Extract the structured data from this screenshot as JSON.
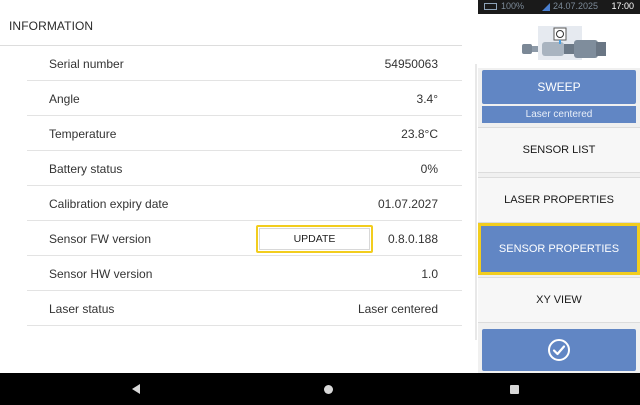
{
  "info": {
    "title": "INFORMATION",
    "rows": [
      {
        "label": "Serial number",
        "value": "54950063"
      },
      {
        "label": "Angle",
        "value": "3.4°"
      },
      {
        "label": "Temperature",
        "value": "23.8°C"
      },
      {
        "label": "Battery status",
        "value": "0%"
      },
      {
        "label": "Calibration expiry date",
        "value": "01.07.2027"
      },
      {
        "label": "Sensor FW version",
        "value": "0.8.0.188",
        "button": "UPDATE"
      },
      {
        "label": "Sensor HW version",
        "value": "1.0"
      },
      {
        "label": "Laser status",
        "value": "Laser centered"
      }
    ]
  },
  "status": {
    "battery": "100%",
    "date": "24.07.2025",
    "time": "17:00"
  },
  "sidebar": {
    "sweep": "SWEEP",
    "laser_status": "Laser centered",
    "menu": [
      "SENSOR LIST",
      "LASER PROPERTIES",
      "SENSOR PROPERTIES",
      "XY VIEW"
    ],
    "active": "SENSOR PROPERTIES"
  },
  "colors": {
    "accent": "#6186c4",
    "highlight": "#f2cd1e"
  },
  "icons": {
    "confirm": "check-circle-icon",
    "nav": [
      "back-icon",
      "home-icon",
      "recents-icon"
    ]
  }
}
